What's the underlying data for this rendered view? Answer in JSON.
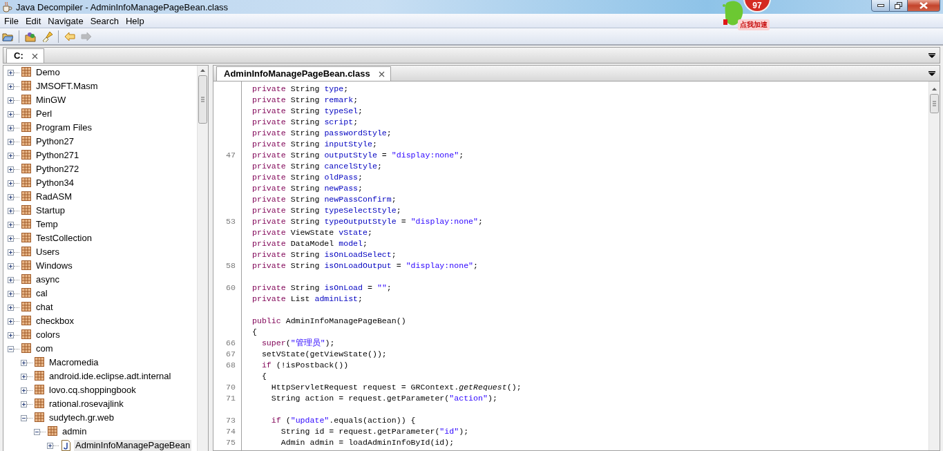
{
  "window": {
    "title": "Java Decompiler - AdminInfoManagePageBean.class"
  },
  "menu": [
    "File",
    "Edit",
    "Navigate",
    "Search",
    "Help"
  ],
  "toolbar": [
    {
      "kind": "open",
      "disabled": false
    },
    {
      "kind": "separator"
    },
    {
      "kind": "open-type",
      "disabled": false
    },
    {
      "kind": "search",
      "disabled": false
    },
    {
      "kind": "separator"
    },
    {
      "kind": "back",
      "disabled": false
    },
    {
      "kind": "forward",
      "disabled": true
    }
  ],
  "overlay": {
    "badge": "97",
    "caption": "点我加速"
  },
  "archive_tabs": [
    {
      "label": "C:",
      "selected": true
    }
  ],
  "tree": [
    {
      "label": "Demo",
      "kind": "package",
      "expanded": false,
      "selected": false
    },
    {
      "label": "JMSOFT.Masm",
      "kind": "package",
      "expanded": false,
      "selected": false
    },
    {
      "label": "MinGW",
      "kind": "package",
      "expanded": false,
      "selected": false
    },
    {
      "label": "Perl",
      "kind": "package",
      "expanded": false,
      "selected": false
    },
    {
      "label": "Program Files",
      "kind": "package",
      "expanded": false,
      "selected": false
    },
    {
      "label": "Python27",
      "kind": "package",
      "expanded": false,
      "selected": false
    },
    {
      "label": "Python271",
      "kind": "package",
      "expanded": false,
      "selected": false
    },
    {
      "label": "Python272",
      "kind": "package",
      "expanded": false,
      "selected": false
    },
    {
      "label": "Python34",
      "kind": "package",
      "expanded": false,
      "selected": false
    },
    {
      "label": "RadASM",
      "kind": "package",
      "expanded": false,
      "selected": false
    },
    {
      "label": "Startup",
      "kind": "package",
      "expanded": false,
      "selected": false
    },
    {
      "label": "Temp",
      "kind": "package",
      "expanded": false,
      "selected": false
    },
    {
      "label": "TestCollection",
      "kind": "package",
      "expanded": false,
      "selected": false
    },
    {
      "label": "Users",
      "kind": "package",
      "expanded": false,
      "selected": false
    },
    {
      "label": "Windows",
      "kind": "package",
      "expanded": false,
      "selected": false
    },
    {
      "label": "async",
      "kind": "package",
      "expanded": false,
      "selected": false
    },
    {
      "label": "cal",
      "kind": "package",
      "expanded": false,
      "selected": false
    },
    {
      "label": "chat",
      "kind": "package",
      "expanded": false,
      "selected": false
    },
    {
      "label": "checkbox",
      "kind": "package",
      "expanded": false,
      "selected": false
    },
    {
      "label": "colors",
      "kind": "package",
      "expanded": false,
      "selected": false
    },
    {
      "label": "com",
      "kind": "package",
      "expanded": true,
      "selected": false,
      "children": [
        {
          "label": "Macromedia",
          "kind": "package",
          "expanded": false,
          "selected": false
        },
        {
          "label": "android.ide.eclipse.adt.internal",
          "kind": "package",
          "expanded": false,
          "selected": false
        },
        {
          "label": "lovo.cq.shoppingbook",
          "kind": "package",
          "expanded": false,
          "selected": false
        },
        {
          "label": "rational.rosevajlink",
          "kind": "package",
          "expanded": false,
          "selected": false
        },
        {
          "label": "sudytech.gr.web",
          "kind": "package",
          "expanded": true,
          "selected": false,
          "children": [
            {
              "label": "admin",
              "kind": "package",
              "expanded": true,
              "selected": false,
              "children": [
                {
                  "label": "AdminInfoManagePageBean",
                  "kind": "class",
                  "expanded": false,
                  "selected": true
                }
              ]
            }
          ]
        }
      ]
    }
  ],
  "file_tabs": [
    {
      "label": "AdminInfoManagePageBean.class",
      "selected": true
    }
  ],
  "code_lines": [
    {
      "kind": "code",
      "tokens": [
        {
          "kind": "keyword",
          "text": "private"
        },
        {
          "kind": "plain",
          "text": " String "
        },
        {
          "kind": "field",
          "text": "type"
        },
        {
          "kind": "plain",
          "text": ";"
        }
      ]
    },
    {
      "kind": "code",
      "tokens": [
        {
          "kind": "keyword",
          "text": "private"
        },
        {
          "kind": "plain",
          "text": " String "
        },
        {
          "kind": "field",
          "text": "remark"
        },
        {
          "kind": "plain",
          "text": ";"
        }
      ]
    },
    {
      "kind": "code",
      "tokens": [
        {
          "kind": "keyword",
          "text": "private"
        },
        {
          "kind": "plain",
          "text": " String "
        },
        {
          "kind": "field",
          "text": "typeSel"
        },
        {
          "kind": "plain",
          "text": ";"
        }
      ]
    },
    {
      "kind": "code",
      "tokens": [
        {
          "kind": "keyword",
          "text": "private"
        },
        {
          "kind": "plain",
          "text": " String "
        },
        {
          "kind": "field",
          "text": "script"
        },
        {
          "kind": "plain",
          "text": ";"
        }
      ]
    },
    {
      "kind": "code",
      "tokens": [
        {
          "kind": "keyword",
          "text": "private"
        },
        {
          "kind": "plain",
          "text": " String "
        },
        {
          "kind": "field",
          "text": "passwordStyle"
        },
        {
          "kind": "plain",
          "text": ";"
        }
      ]
    },
    {
      "kind": "code",
      "tokens": [
        {
          "kind": "keyword",
          "text": "private"
        },
        {
          "kind": "plain",
          "text": " String "
        },
        {
          "kind": "field",
          "text": "inputStyle"
        },
        {
          "kind": "plain",
          "text": ";"
        }
      ]
    },
    {
      "kind": "code",
      "number": "47",
      "tokens": [
        {
          "kind": "keyword",
          "text": "private"
        },
        {
          "kind": "plain",
          "text": " String "
        },
        {
          "kind": "field",
          "text": "outputStyle"
        },
        {
          "kind": "plain",
          "text": " = "
        },
        {
          "kind": "string",
          "text": "\"display:none\""
        },
        {
          "kind": "plain",
          "text": ";"
        }
      ]
    },
    {
      "kind": "code",
      "tokens": [
        {
          "kind": "keyword",
          "text": "private"
        },
        {
          "kind": "plain",
          "text": " String "
        },
        {
          "kind": "field",
          "text": "cancelStyle"
        },
        {
          "kind": "plain",
          "text": ";"
        }
      ]
    },
    {
      "kind": "code",
      "tokens": [
        {
          "kind": "keyword",
          "text": "private"
        },
        {
          "kind": "plain",
          "text": " String "
        },
        {
          "kind": "field",
          "text": "oldPass"
        },
        {
          "kind": "plain",
          "text": ";"
        }
      ]
    },
    {
      "kind": "code",
      "tokens": [
        {
          "kind": "keyword",
          "text": "private"
        },
        {
          "kind": "plain",
          "text": " String "
        },
        {
          "kind": "field",
          "text": "newPass"
        },
        {
          "kind": "plain",
          "text": ";"
        }
      ]
    },
    {
      "kind": "code",
      "tokens": [
        {
          "kind": "keyword",
          "text": "private"
        },
        {
          "kind": "plain",
          "text": " String "
        },
        {
          "kind": "field",
          "text": "newPassConfirm"
        },
        {
          "kind": "plain",
          "text": ";"
        }
      ]
    },
    {
      "kind": "code",
      "tokens": [
        {
          "kind": "keyword",
          "text": "private"
        },
        {
          "kind": "plain",
          "text": " String "
        },
        {
          "kind": "field",
          "text": "typeSelectStyle"
        },
        {
          "kind": "plain",
          "text": ";"
        }
      ]
    },
    {
      "kind": "code",
      "number": "53",
      "tokens": [
        {
          "kind": "keyword",
          "text": "private"
        },
        {
          "kind": "plain",
          "text": " String "
        },
        {
          "kind": "field",
          "text": "typeOutputStyle"
        },
        {
          "kind": "plain",
          "text": " = "
        },
        {
          "kind": "string",
          "text": "\"display:none\""
        },
        {
          "kind": "plain",
          "text": ";"
        }
      ]
    },
    {
      "kind": "code",
      "tokens": [
        {
          "kind": "keyword",
          "text": "private"
        },
        {
          "kind": "plain",
          "text": " ViewState "
        },
        {
          "kind": "field",
          "text": "vState"
        },
        {
          "kind": "plain",
          "text": ";"
        }
      ]
    },
    {
      "kind": "code",
      "tokens": [
        {
          "kind": "keyword",
          "text": "private"
        },
        {
          "kind": "plain",
          "text": " DataModel "
        },
        {
          "kind": "field",
          "text": "model"
        },
        {
          "kind": "plain",
          "text": ";"
        }
      ]
    },
    {
      "kind": "code",
      "tokens": [
        {
          "kind": "keyword",
          "text": "private"
        },
        {
          "kind": "plain",
          "text": " String "
        },
        {
          "kind": "field",
          "text": "isOnLoadSelect"
        },
        {
          "kind": "plain",
          "text": ";"
        }
      ]
    },
    {
      "kind": "code",
      "number": "58",
      "tokens": [
        {
          "kind": "keyword",
          "text": "private"
        },
        {
          "kind": "plain",
          "text": " String "
        },
        {
          "kind": "field",
          "text": "isOnLoadOutput"
        },
        {
          "kind": "plain",
          "text": " = "
        },
        {
          "kind": "string",
          "text": "\"display:none\""
        },
        {
          "kind": "plain",
          "text": ";"
        }
      ]
    },
    {
      "kind": "blank"
    },
    {
      "kind": "code",
      "number": "60",
      "tokens": [
        {
          "kind": "keyword",
          "text": "private"
        },
        {
          "kind": "plain",
          "text": " String "
        },
        {
          "kind": "field",
          "text": "isOnLoad"
        },
        {
          "kind": "plain",
          "text": " = "
        },
        {
          "kind": "string",
          "text": "\"\""
        },
        {
          "kind": "plain",
          "text": ";"
        }
      ]
    },
    {
      "kind": "code",
      "tokens": [
        {
          "kind": "keyword",
          "text": "private"
        },
        {
          "kind": "plain",
          "text": " List "
        },
        {
          "kind": "field",
          "text": "adminList"
        },
        {
          "kind": "plain",
          "text": ";"
        }
      ]
    },
    {
      "kind": "blank"
    },
    {
      "kind": "code",
      "tokens": [
        {
          "kind": "keyword",
          "text": "public"
        },
        {
          "kind": "plain",
          "text": " AdminInfoManagePageBean()"
        }
      ]
    },
    {
      "kind": "code",
      "tokens": [
        {
          "kind": "plain",
          "text": "{"
        }
      ]
    },
    {
      "kind": "code",
      "number": "66",
      "tokens": [
        {
          "kind": "keyword",
          "text": "  super"
        },
        {
          "kind": "plain",
          "text": "("
        },
        {
          "kind": "string",
          "text": "\"管理员\""
        },
        {
          "kind": "plain",
          "text": ");"
        }
      ]
    },
    {
      "kind": "code",
      "number": "67",
      "tokens": [
        {
          "kind": "plain",
          "text": "  setVState(getViewState());"
        }
      ]
    },
    {
      "kind": "code",
      "number": "68",
      "tokens": [
        {
          "kind": "keyword",
          "text": "  if"
        },
        {
          "kind": "plain",
          "text": " (!isPostback())"
        }
      ]
    },
    {
      "kind": "code",
      "tokens": [
        {
          "kind": "plain",
          "text": "  {"
        }
      ]
    },
    {
      "kind": "code",
      "number": "70",
      "tokens": [
        {
          "kind": "plain",
          "text": "    HttpServletRequest request = GRContext."
        },
        {
          "kind": "static",
          "text": "getRequest"
        },
        {
          "kind": "plain",
          "text": "();"
        }
      ]
    },
    {
      "kind": "code",
      "number": "71",
      "tokens": [
        {
          "kind": "plain",
          "text": "    String action = request.getParameter("
        },
        {
          "kind": "string",
          "text": "\"action\""
        },
        {
          "kind": "plain",
          "text": ");"
        }
      ]
    },
    {
      "kind": "blank"
    },
    {
      "kind": "code",
      "number": "73",
      "tokens": [
        {
          "kind": "keyword",
          "text": "    if"
        },
        {
          "kind": "plain",
          "text": " ("
        },
        {
          "kind": "string",
          "text": "\"update\""
        },
        {
          "kind": "plain",
          "text": ".equals(action)) {"
        }
      ]
    },
    {
      "kind": "code",
      "number": "74",
      "tokens": [
        {
          "kind": "plain",
          "text": "      String id = request.getParameter("
        },
        {
          "kind": "string",
          "text": "\"id\""
        },
        {
          "kind": "plain",
          "text": ");"
        }
      ]
    },
    {
      "kind": "code",
      "number": "75",
      "tokens": [
        {
          "kind": "plain",
          "text": "      Admin admin = loadAdminInfoById(id);"
        }
      ]
    }
  ]
}
